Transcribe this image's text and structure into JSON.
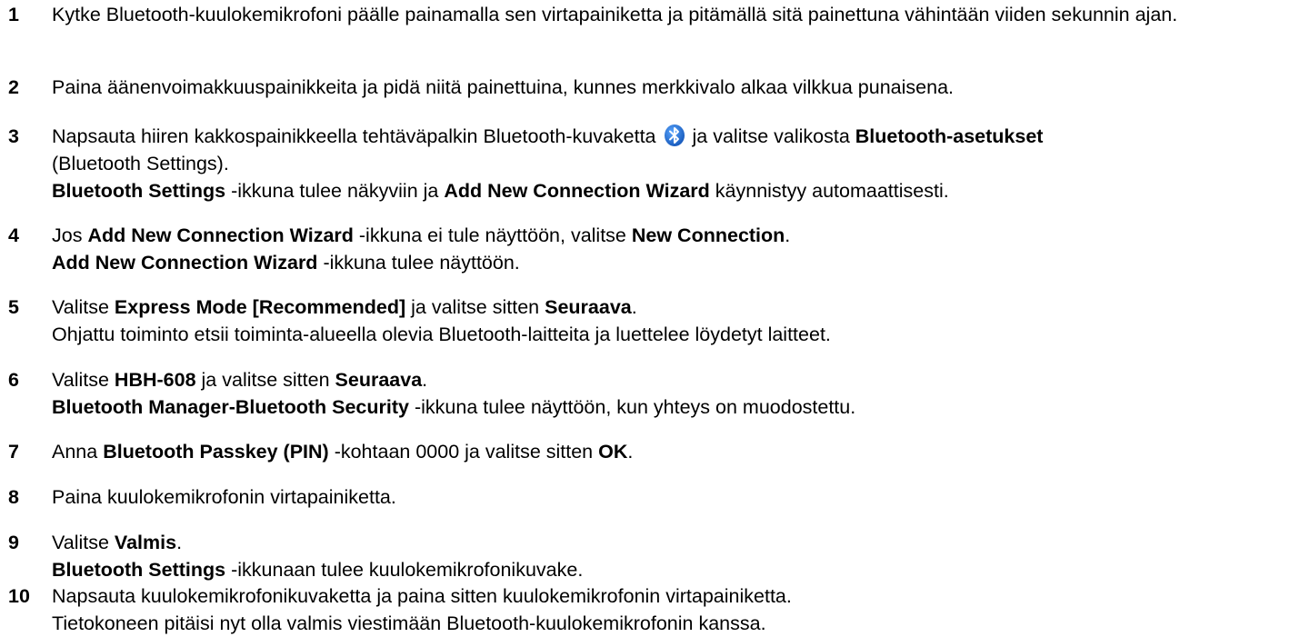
{
  "steps": [
    {
      "number": "1",
      "p1": "Kytke Bluetooth-kuulokemikrofoni päälle painamalla sen virtapainiketta ja pitämällä sitä painettuna vähintään viiden sekunnin ajan."
    },
    {
      "number": "2",
      "p1": "Paina äänenvoimakkuuspainikkeita ja pidä niitä painettuina, kunnes merkkivalo alkaa vilkkua punaisena."
    },
    {
      "number": "3",
      "p1": "Napsauta hiiren kakkospainikkeella tehtäväpalkin Bluetooth-kuvaketta",
      "p2": "ja valitse valikosta",
      "b1": "Bluetooth-asetukset",
      "p3": "(Bluetooth Settings).",
      "b2": "Bluetooth Settings",
      "p4": "-ikkuna tulee näkyviin ja",
      "b3": "Add New Connection Wizard",
      "p5": "käynnistyy automaattisesti."
    },
    {
      "number": "4",
      "p1": "Jos",
      "b1": "Add New Connection Wizard",
      "p2": "-ikkuna ei tule näyttöön, valitse",
      "b2": "New Connection",
      "p3": ".",
      "b3": "Add New Connection Wizard",
      "p4": "-ikkuna tulee näyttöön."
    },
    {
      "number": "5",
      "p1": "Valitse",
      "b1": "Express Mode [Recommended]",
      "p2": "ja valitse sitten",
      "b2": "Seuraava",
      "p3": ".",
      "p4": "Ohjattu toiminto etsii toiminta-alueella olevia Bluetooth-laitteita ja luettelee löydetyt laitteet."
    },
    {
      "number": "6",
      "p1": "Valitse",
      "b1": "HBH-608",
      "p2": "ja valitse sitten",
      "b2": "Seuraava",
      "p3": ".",
      "b3": "Bluetooth Manager-Bluetooth Security",
      "p4": "-ikkuna tulee näyttöön, kun yhteys on muodostettu."
    },
    {
      "number": "7",
      "p1": "Anna",
      "b1": "Bluetooth Passkey (PIN)",
      "p2": "-kohtaan 0000 ja valitse sitten",
      "b2": "OK",
      "p3": "."
    },
    {
      "number": "8",
      "p1": "Paina kuulokemikrofonin virtapainiketta."
    },
    {
      "number": "9",
      "p1": "Valitse",
      "b1": "Valmis",
      "p2": ".",
      "b2": "Bluetooth Settings",
      "p3": "-ikkunaan tulee kuulokemikrofonikuvake."
    },
    {
      "number": "10",
      "p1": "Napsauta kuulokemikrofonikuvaketta ja paina sitten kuulokemikrofonin virtapainiketta.",
      "p2": "Tietokoneen pitäisi nyt olla valmis viestimään Bluetooth-kuulokemikrofonin kanssa."
    }
  ],
  "icons": {
    "bluetooth": "bluetooth-icon"
  },
  "colors": {
    "text": "#000000",
    "bluetooth_icon_bg": "#1f6fd6",
    "bluetooth_icon_fg": "#ffffff"
  }
}
